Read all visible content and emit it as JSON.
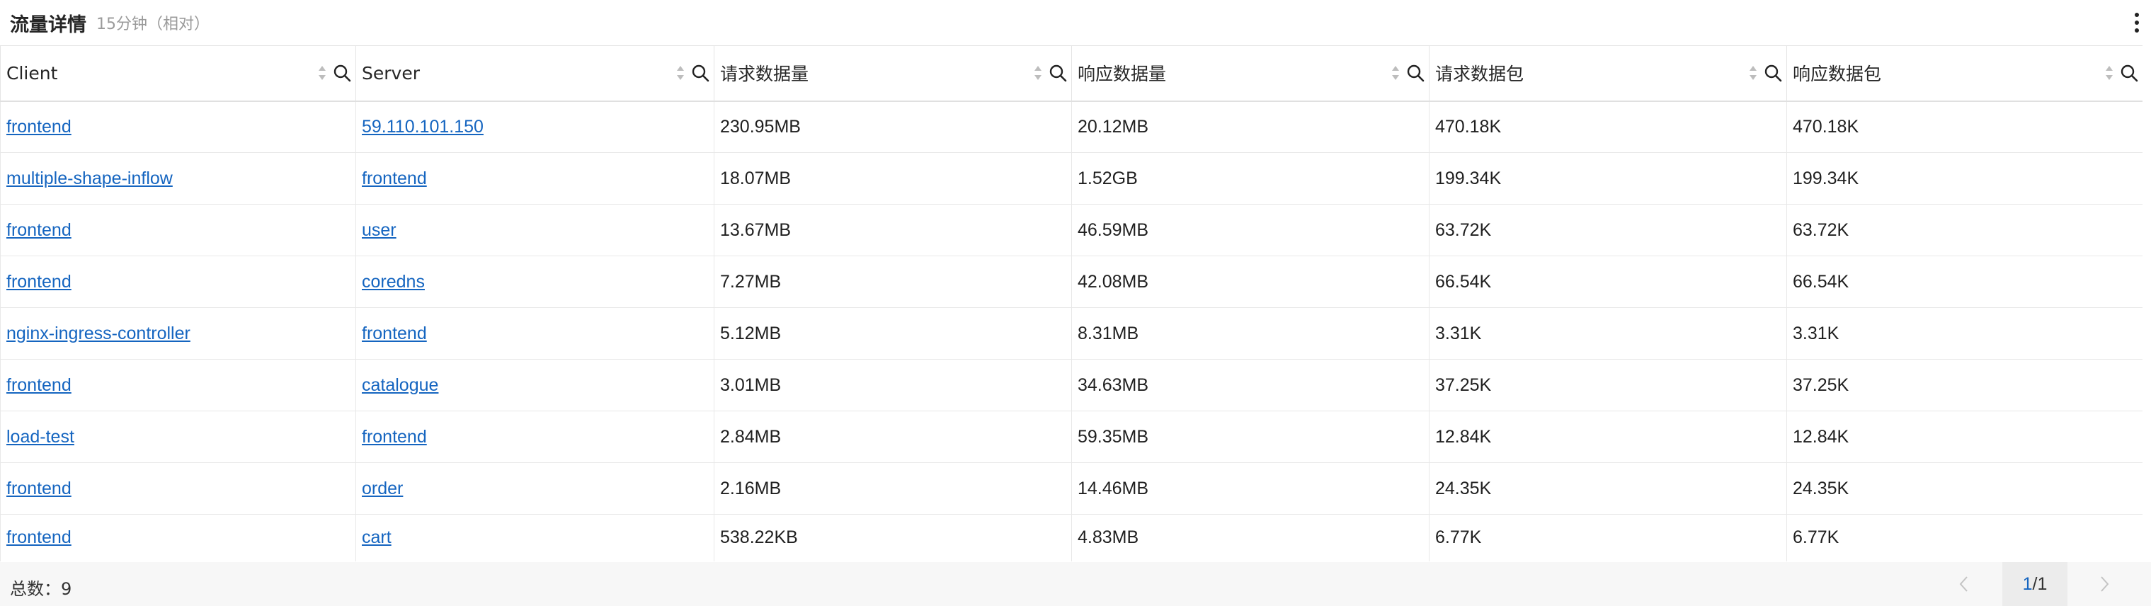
{
  "panel": {
    "title": "流量详情",
    "subtitle": "15分钟（相对）"
  },
  "icons": {
    "more": "more-vertical-icon",
    "sort": "sort-icon",
    "search": "search-icon",
    "prev": "chevron-left-icon",
    "next": "chevron-right-icon"
  },
  "table": {
    "columns": [
      "Client",
      "Server",
      "请求数据量",
      "响应数据量",
      "请求数据包",
      "响应数据包"
    ],
    "rows": [
      [
        "frontend",
        "59.110.101.150",
        "230.95MB",
        "20.12MB",
        "470.18K",
        "470.18K"
      ],
      [
        "multiple-shape-inflow",
        "frontend",
        "18.07MB",
        "1.52GB",
        "199.34K",
        "199.34K"
      ],
      [
        "frontend",
        "user",
        "13.67MB",
        "46.59MB",
        "63.72K",
        "63.72K"
      ],
      [
        "frontend",
        "coredns",
        "7.27MB",
        "42.08MB",
        "66.54K",
        "66.54K"
      ],
      [
        "nginx-ingress-controller",
        "frontend",
        "5.12MB",
        "8.31MB",
        "3.31K",
        "3.31K"
      ],
      [
        "frontend",
        "catalogue",
        "3.01MB",
        "34.63MB",
        "37.25K",
        "37.25K"
      ],
      [
        "load-test",
        "frontend",
        "2.84MB",
        "59.35MB",
        "12.84K",
        "12.84K"
      ],
      [
        "frontend",
        "order",
        "2.16MB",
        "14.46MB",
        "24.35K",
        "24.35K"
      ],
      [
        "frontend",
        "cart",
        "538.22KB",
        "4.83MB",
        "6.77K",
        "6.77K"
      ]
    ]
  },
  "footer": {
    "total": "总数：9",
    "page_current": "1",
    "page_total": "/1"
  },
  "colors": {
    "link": "#1565c0",
    "footer_bg": "#f7f7f7",
    "border": "#e8e8e8"
  }
}
